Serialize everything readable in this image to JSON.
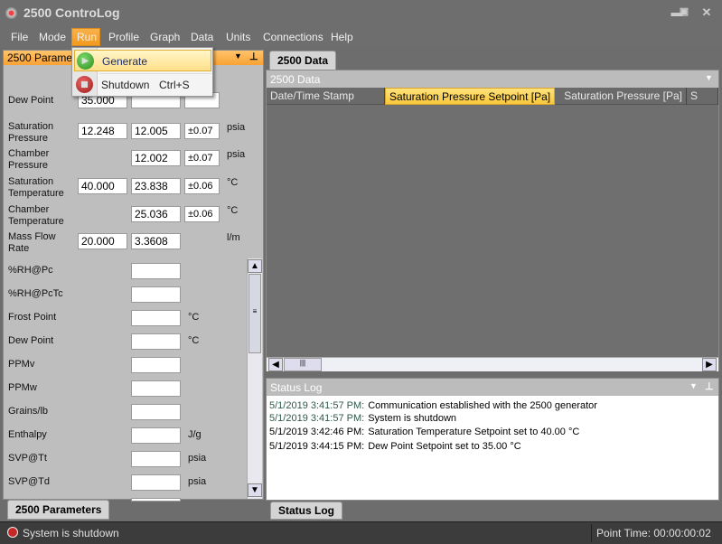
{
  "window": {
    "title": "2500 ControLog",
    "icon": "app-logo-icon",
    "controls": [
      "minimize-icon",
      "maximize-icon",
      "close-icon"
    ]
  },
  "menu": {
    "items": [
      "File",
      "Mode",
      "Run",
      "Profile",
      "Graph",
      "Data",
      "Units",
      "Connections",
      "Help"
    ],
    "active": "Run"
  },
  "run_menu": {
    "items": [
      {
        "label": "Generate",
        "icon": "play-icon",
        "shortcut": ""
      },
      {
        "label": "Shutdown",
        "icon": "stop-icon",
        "shortcut": "Ctrl+S"
      }
    ]
  },
  "params_panel": {
    "title": "2500 Parameters",
    "tab": "2500 Parameters",
    "rows": [
      {
        "label": "Dew Point",
        "setpoint": "35.000",
        "value": "",
        "tolerance": "",
        "unit": ""
      },
      {
        "label": "Saturation Pressure",
        "setpoint": "12.248",
        "value": "12.005",
        "tolerance": "±0.07",
        "unit": "psia"
      },
      {
        "label": "Chamber Pressure",
        "setpoint": null,
        "value": "12.002",
        "tolerance": "±0.07",
        "unit": "psia"
      },
      {
        "label": "Saturation Temperature",
        "setpoint": "40.000",
        "value": "23.838",
        "tolerance": "±0.06",
        "unit": "°C"
      },
      {
        "label": "Chamber Temperature",
        "setpoint": null,
        "value": "25.036",
        "tolerance": "±0.06",
        "unit": "°C"
      },
      {
        "label": "Mass Flow Rate",
        "setpoint": "20.000",
        "value": "3.3608",
        "tolerance": null,
        "unit": "l/m"
      }
    ],
    "calc_rows": [
      {
        "label": "%RH@Pc",
        "unit": ""
      },
      {
        "label": "%RH@PcTc",
        "unit": ""
      },
      {
        "label": "Frost Point",
        "unit": "°C"
      },
      {
        "label": "Dew Point",
        "unit": "°C"
      },
      {
        "label": "PPMv",
        "unit": ""
      },
      {
        "label": "PPMw",
        "unit": ""
      },
      {
        "label": "Grains/lb",
        "unit": ""
      },
      {
        "label": "Enthalpy",
        "unit": "J/g"
      },
      {
        "label": "SVP@Tt",
        "unit": "psia"
      },
      {
        "label": "SVP@Td",
        "unit": "psia"
      }
    ]
  },
  "data_panel": {
    "tab": "2500 Data",
    "title": "2500 Data",
    "columns": [
      "Date/Time Stamp",
      "Saturation Pressure Setpoint [Pa]",
      "Saturation Pressure [Pa]",
      "S"
    ],
    "selected_column": "Saturation Pressure Setpoint [Pa]"
  },
  "status_log": {
    "title": "Status Log",
    "tab": "Status Log",
    "entries": [
      {
        "time": "5/1/2019 3:41:57 PM:",
        "message": "Communication established with the 2500 generator",
        "color": "#2e5a4a"
      },
      {
        "time": "5/1/2019 3:41:57 PM:",
        "message": "System is shutdown",
        "color": "#2e5a4a"
      },
      {
        "time": "5/1/2019 3:42:46 PM:",
        "message": "Saturation Temperature Setpoint set to 40.00 °C",
        "color": "#000000"
      },
      {
        "time": "5/1/2019 3:44:15 PM:",
        "message": "Dew Point Setpoint set to 35.00 °C",
        "color": "#000000"
      }
    ]
  },
  "statusbar": {
    "state": "System is shutdown",
    "state_icon": "stop-icon",
    "point_time": "Point Time: 00:00:00:02"
  },
  "colors": {
    "accent": "#f7a93a",
    "highlight": "#ffd966"
  }
}
